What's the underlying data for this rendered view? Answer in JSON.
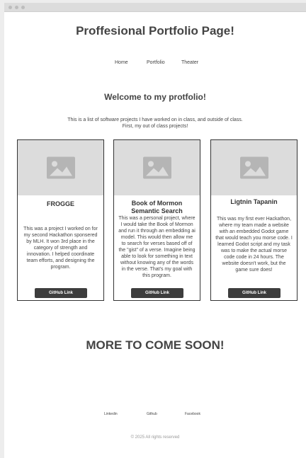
{
  "header": {
    "title": "Proffesional Portfolio Page!"
  },
  "nav": {
    "items": [
      "Home",
      "Portfolio",
      "Theater"
    ]
  },
  "main": {
    "welcome": "Welcome to my protfolio!",
    "intro_line1": "This is a list of software projects I have worked on in class, and outside of class.",
    "intro_line2": "First, my out of class projects!"
  },
  "cards": [
    {
      "title": "FROGGE",
      "description": "This was a project I worked on for my second Hackathon sponsered by MLH. It won 3rd place in the category of strength and innovation. I helped coordinate team efforts, and designing the program.",
      "button": "GitHub Link",
      "image_icon": "image-placeholder-icon"
    },
    {
      "title": "Book of Mormon Semantic Search",
      "description": "This was a personal project, where I would take the Book of Mormon and run it through an embedding ai model. This would then allow me to search for verses based off of the \"gist\" of a verse. Imagine being able to look for something in text without knowing any of the words in the verse. That's my goal with this program.",
      "button": "GitHub Link",
      "image_icon": "image-placeholder-icon"
    },
    {
      "title": "Ligtnin Tapanin",
      "description": "This was my first ever Hackathon, where my team made a website with an embedded Godot game that would teach you morse code. I learned Godot script and my task was to make the actual morse code code in 24 hours. The website doesn't work, but the game sure does!",
      "button": "GitHub Link",
      "image_icon": "image-placeholder-icon"
    }
  ],
  "more": "MORE TO COME SOON!",
  "footer": {
    "links": [
      "Linkedin",
      "Github",
      "Facebook"
    ],
    "copyright": "© 2025 All rights reserved"
  },
  "colors": {
    "heading": "#444444",
    "button_bg": "#3d3d3d",
    "placeholder_bg": "#dcdcdc"
  }
}
